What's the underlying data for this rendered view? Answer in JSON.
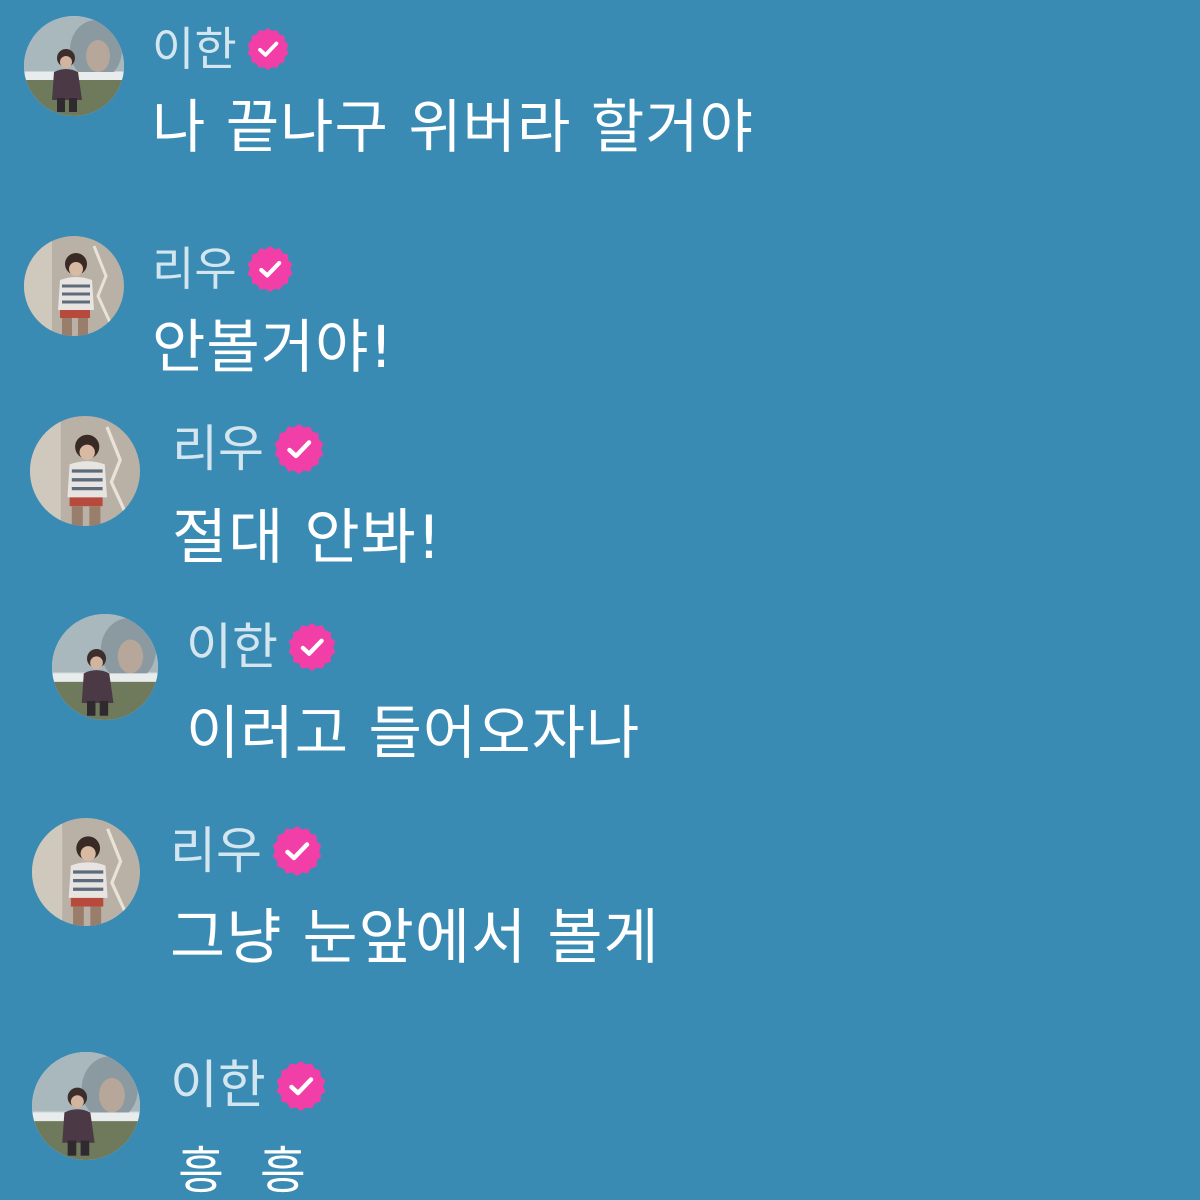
{
  "theme": {
    "background": "#3a8bb4",
    "text_color": "#ffffff",
    "badge_color": "#f23fa8"
  },
  "chat": {
    "messages": [
      {
        "sender": "이한",
        "avatar": "idol-photo-avatar-ihan",
        "verified_icon": "verified-badge-icon",
        "text": "나 끝나구 위버라 할거야"
      },
      {
        "sender": "리우",
        "avatar": "idol-photo-avatar-riu",
        "verified_icon": "verified-badge-icon",
        "text": "안볼거야!"
      },
      {
        "sender": "리우",
        "avatar": "idol-photo-avatar-riu",
        "verified_icon": "verified-badge-icon",
        "text": "절대 안봐!"
      },
      {
        "sender": "이한",
        "avatar": "idol-photo-avatar-ihan",
        "verified_icon": "verified-badge-icon",
        "text": "이러고 들어오자나"
      },
      {
        "sender": "리우",
        "avatar": "idol-photo-avatar-riu",
        "verified_icon": "verified-badge-icon",
        "text": "그냥 눈앞에서 볼게"
      },
      {
        "sender": "이한",
        "avatar": "idol-photo-avatar-ihan",
        "verified_icon": "verified-badge-icon",
        "text": "흥 흥"
      }
    ]
  }
}
